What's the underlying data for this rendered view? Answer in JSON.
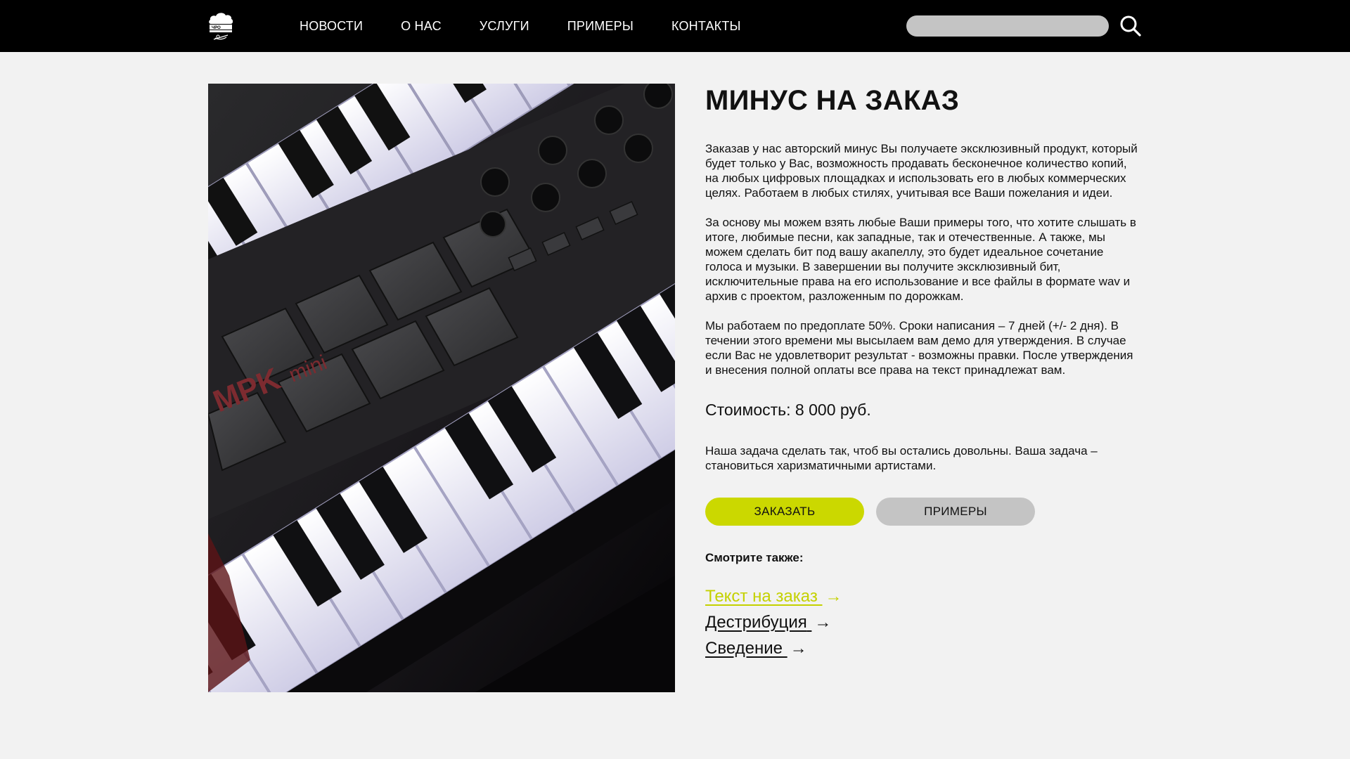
{
  "header": {
    "nav": [
      "НОВОСТИ",
      "О НАС",
      "УСЛУГИ",
      "ПРИМЕРЫ",
      "КОНТАКТЫ"
    ],
    "search_placeholder": "",
    "search_icon": "search-icon",
    "logo_icon": "cloud-logo-icon"
  },
  "main": {
    "image_alt": "MIDI-клавиатура MPK mini",
    "image_brand_text": "MPK mini",
    "title": "МИНУС НА ЗАКАЗ",
    "paragraphs": [
      "Заказав у нас авторский минус Вы получаете эксклюзивный продукт, который будет только у Вас, возможность продавать бесконечное количество копий, на любых цифровых площадках и использовать его в любых коммерческих целях. Работаем в любых стилях, учитывая все Ваши пожелания и идеи.",
      "За основу мы можем взять любые Ваши примеры того, что хотите слышать в итоге, любимые песни, как западные, так и отечественные. А также, мы можем сделать бит под вашу акапеллу, это будет идеальное сочетание голоса и музыки. В завершении вы получите эксклюзивный бит, исключительные права на его использование и все файлы в формате wav и архив с проектом, разложенным по дорожкам.",
      "Мы работаем по предоплате 50%. Сроки написания – 7 дней (+/- 2 дня). В течении этого времени мы высылаем вам демо для утверждения. В случае если Вас не удовлетворит результат - возможны правки. После утверждения и внесения полной оплаты все права на текст принадлежат вам."
    ],
    "price": "Стоимость: 8 000 руб.",
    "closing": "Наша задача сделать так, чтоб вы остались довольны. Ваша задача – становиться харизматичными артистами.",
    "buttons": {
      "order": "ЗАКАЗАТЬ",
      "examples": "ПРИМЕРЫ"
    },
    "see_also_label": "Смотрите также:",
    "see_also": [
      {
        "label": "Текст на заказ ",
        "arrow": "→",
        "active": true
      },
      {
        "label": "Дестрибуция",
        "arrow": "→",
        "active": false
      },
      {
        "label": "Сведение",
        "arrow": "→",
        "active": false
      }
    ]
  },
  "colors": {
    "accent": "#cbd800",
    "header_bg": "#000000",
    "page_bg": "#f2f2f2",
    "button_gray": "#c4c4c4"
  }
}
